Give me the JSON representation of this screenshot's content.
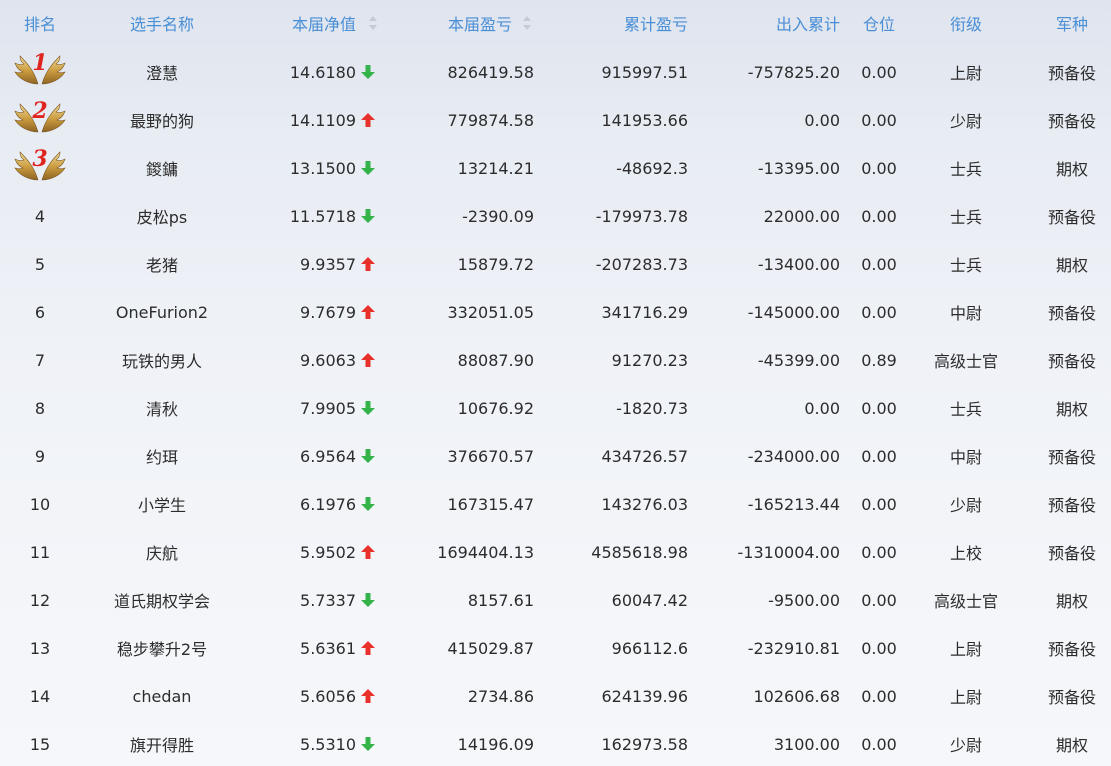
{
  "header": {
    "rank": "排名",
    "name": "选手名称",
    "nav": "本届净值",
    "pl": "本届盈亏",
    "cumulative": "累计盈亏",
    "flow": "出入累计",
    "position": "仓位",
    "military_rank": "衔级",
    "arm": "军种"
  },
  "colors": {
    "header_text": "#4a8fd6",
    "up_arrow": "#e8312a",
    "down_arrow": "#33b34a",
    "rank_digit": "#e0241f"
  },
  "rows": [
    {
      "rank": "1",
      "medal": "gold-wings-1",
      "name": "澄慧",
      "nav": "14.6180",
      "trend": "down",
      "pl": "826419.58",
      "cumulative": "915997.51",
      "flow": "-757825.20",
      "position": "0.00",
      "military_rank": "上尉",
      "arm": "预备役"
    },
    {
      "rank": "2",
      "medal": "gold-wings-2",
      "name": "最野的狗",
      "nav": "14.1109",
      "trend": "up",
      "pl": "779874.58",
      "cumulative": "141953.66",
      "flow": "0.00",
      "position": "0.00",
      "military_rank": "少尉",
      "arm": "预备役"
    },
    {
      "rank": "3",
      "medal": "gold-wings-3",
      "name": "鍐鏞",
      "nav": "13.1500",
      "trend": "down",
      "pl": "13214.21",
      "cumulative": "-48692.3",
      "flow": "-13395.00",
      "position": "0.00",
      "military_rank": "士兵",
      "arm": "期权"
    },
    {
      "rank": "4",
      "name": "皮松ps",
      "nav": "11.5718",
      "trend": "down",
      "pl": "-2390.09",
      "cumulative": "-179973.78",
      "flow": "22000.00",
      "position": "0.00",
      "military_rank": "士兵",
      "arm": "预备役"
    },
    {
      "rank": "5",
      "name": "老猪",
      "nav": "9.9357",
      "trend": "up",
      "pl": "15879.72",
      "cumulative": "-207283.73",
      "flow": "-13400.00",
      "position": "0.00",
      "military_rank": "士兵",
      "arm": "期权"
    },
    {
      "rank": "6",
      "name": "OneFurion2",
      "nav": "9.7679",
      "trend": "up",
      "pl": "332051.05",
      "cumulative": "341716.29",
      "flow": "-145000.00",
      "position": "0.00",
      "military_rank": "中尉",
      "arm": "预备役"
    },
    {
      "rank": "7",
      "name": "玩铁的男人",
      "nav": "9.6063",
      "trend": "up",
      "pl": "88087.90",
      "cumulative": "91270.23",
      "flow": "-45399.00",
      "position": "0.89",
      "military_rank": "高级士官",
      "arm": "预备役"
    },
    {
      "rank": "8",
      "name": "清秋",
      "nav": "7.9905",
      "trend": "down",
      "pl": "10676.92",
      "cumulative": "-1820.73",
      "flow": "0.00",
      "position": "0.00",
      "military_rank": "士兵",
      "arm": "期权"
    },
    {
      "rank": "9",
      "name": "约珥",
      "nav": "6.9564",
      "trend": "down",
      "pl": "376670.57",
      "cumulative": "434726.57",
      "flow": "-234000.00",
      "position": "0.00",
      "military_rank": "中尉",
      "arm": "预备役"
    },
    {
      "rank": "10",
      "name": "小学生",
      "nav": "6.1976",
      "trend": "down",
      "pl": "167315.47",
      "cumulative": "143276.03",
      "flow": "-165213.44",
      "position": "0.00",
      "military_rank": "少尉",
      "arm": "预备役"
    },
    {
      "rank": "11",
      "name": "庆航",
      "nav": "5.9502",
      "trend": "up",
      "pl": "1694404.13",
      "cumulative": "4585618.98",
      "flow": "-1310004.00",
      "position": "0.00",
      "military_rank": "上校",
      "arm": "预备役"
    },
    {
      "rank": "12",
      "name": "道氏期权学会",
      "nav": "5.7337",
      "trend": "down",
      "pl": "8157.61",
      "cumulative": "60047.42",
      "flow": "-9500.00",
      "position": "0.00",
      "military_rank": "高级士官",
      "arm": "期权"
    },
    {
      "rank": "13",
      "name": "稳步攀升2号",
      "nav": "5.6361",
      "trend": "up",
      "pl": "415029.87",
      "cumulative": "966112.6",
      "flow": "-232910.81",
      "position": "0.00",
      "military_rank": "上尉",
      "arm": "预备役"
    },
    {
      "rank": "14",
      "name": "chedan",
      "nav": "5.6056",
      "trend": "up",
      "pl": "2734.86",
      "cumulative": "624139.96",
      "flow": "102606.68",
      "position": "0.00",
      "military_rank": "上尉",
      "arm": "预备役"
    },
    {
      "rank": "15",
      "name": "旗开得胜",
      "nav": "5.5310",
      "trend": "down",
      "pl": "14196.09",
      "cumulative": "162973.58",
      "flow": "3100.00",
      "position": "0.00",
      "military_rank": "少尉",
      "arm": "期权"
    }
  ]
}
